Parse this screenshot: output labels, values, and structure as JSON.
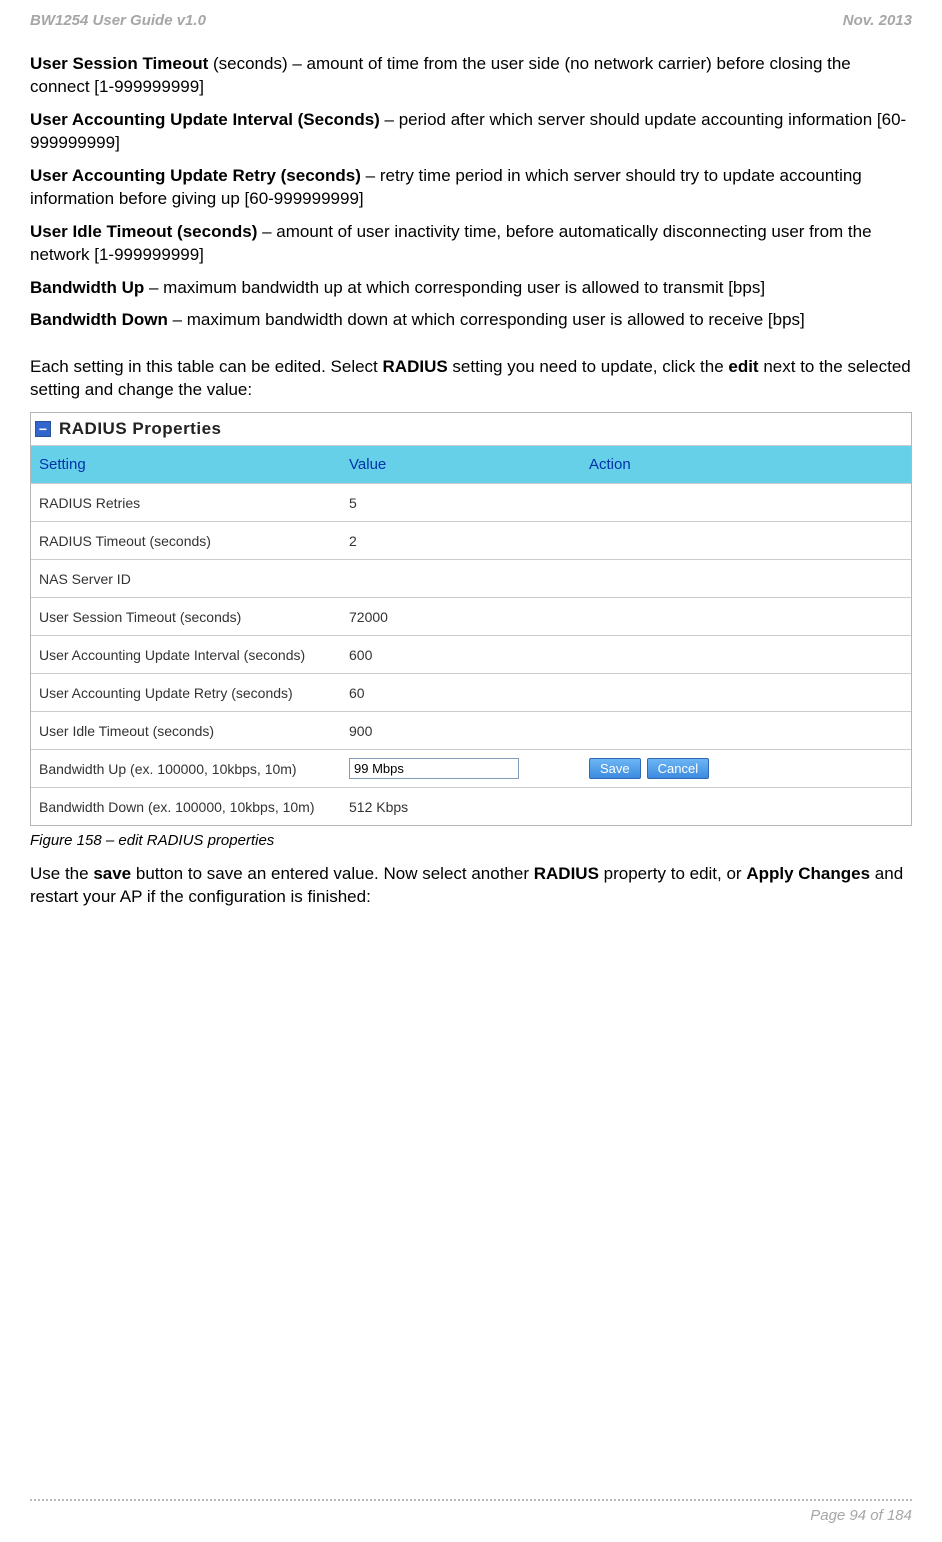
{
  "header": {
    "left": "BW1254 User Guide v1.0",
    "right": "Nov.  2013"
  },
  "paragraphs": {
    "p1_bold": "User Session Timeout",
    "p1_rest": " (seconds) – amount of time from the user side (no network carrier) before closing the connect [1-999999999]",
    "p2_bold": "User Accounting Update Interval (Seconds)",
    "p2_rest": " – period after which server should update accounting information [60-999999999]",
    "p3_bold": "User Accounting Update Retry (seconds)",
    "p3_rest": " – retry time period in which server should try to update accounting information before giving up [60-999999999]",
    "p4_bold": "User Idle Timeout (seconds)",
    "p4_rest": " – amount of user inactivity time, before automatically disconnecting user from the network [1-999999999]",
    "p5_bold": "Bandwidth Up",
    "p5_rest": " – maximum bandwidth up at which corresponding user is allowed to transmit [bps]",
    "p6_bold": "Bandwidth Down",
    "p6_rest": " – maximum bandwidth down at which corresponding user is allowed to receive [bps]",
    "intro_pre": "Each setting in this table can be edited. Select ",
    "intro_b1": "RADIUS",
    "intro_mid": " setting you need to update, click the ",
    "intro_b2": "edit",
    "intro_end": " next to the selected setting and change the value:"
  },
  "table": {
    "title": "RADIUS Properties",
    "headers": {
      "setting": "Setting",
      "value": "Value",
      "action": "Action"
    },
    "rows": [
      {
        "setting": "RADIUS Retries",
        "value": "5",
        "editing": false
      },
      {
        "setting": "RADIUS Timeout (seconds)",
        "value": "2",
        "editing": false
      },
      {
        "setting": "NAS Server ID",
        "value": "",
        "editing": false
      },
      {
        "setting": "User Session Timeout (seconds)",
        "value": "72000",
        "editing": false
      },
      {
        "setting": "User Accounting Update Interval (seconds)",
        "value": "600",
        "editing": false
      },
      {
        "setting": "User Accounting Update Retry (seconds)",
        "value": "60",
        "editing": false
      },
      {
        "setting": "User Idle Timeout (seconds)",
        "value": "900",
        "editing": false
      },
      {
        "setting": "Bandwidth Up (ex. 100000, 10kbps, 10m)",
        "value": "99 Mbps",
        "editing": true
      },
      {
        "setting": "Bandwidth Down (ex. 100000, 10kbps, 10m)",
        "value": "512 Kbps",
        "editing": false
      }
    ],
    "buttons": {
      "save": "Save",
      "cancel": "Cancel"
    }
  },
  "figure_caption": "Figure 158 – edit RADIUS properties",
  "outro": {
    "pre": "Use the ",
    "b1": "save",
    "mid1": " button to save an entered value. Now select another ",
    "b2": "RADIUS",
    "mid2": " property to edit, or ",
    "b3": "Apply Changes",
    "end": " and restart your AP if the configuration is finished:"
  },
  "footer": {
    "page": "Page 94 of 184"
  }
}
